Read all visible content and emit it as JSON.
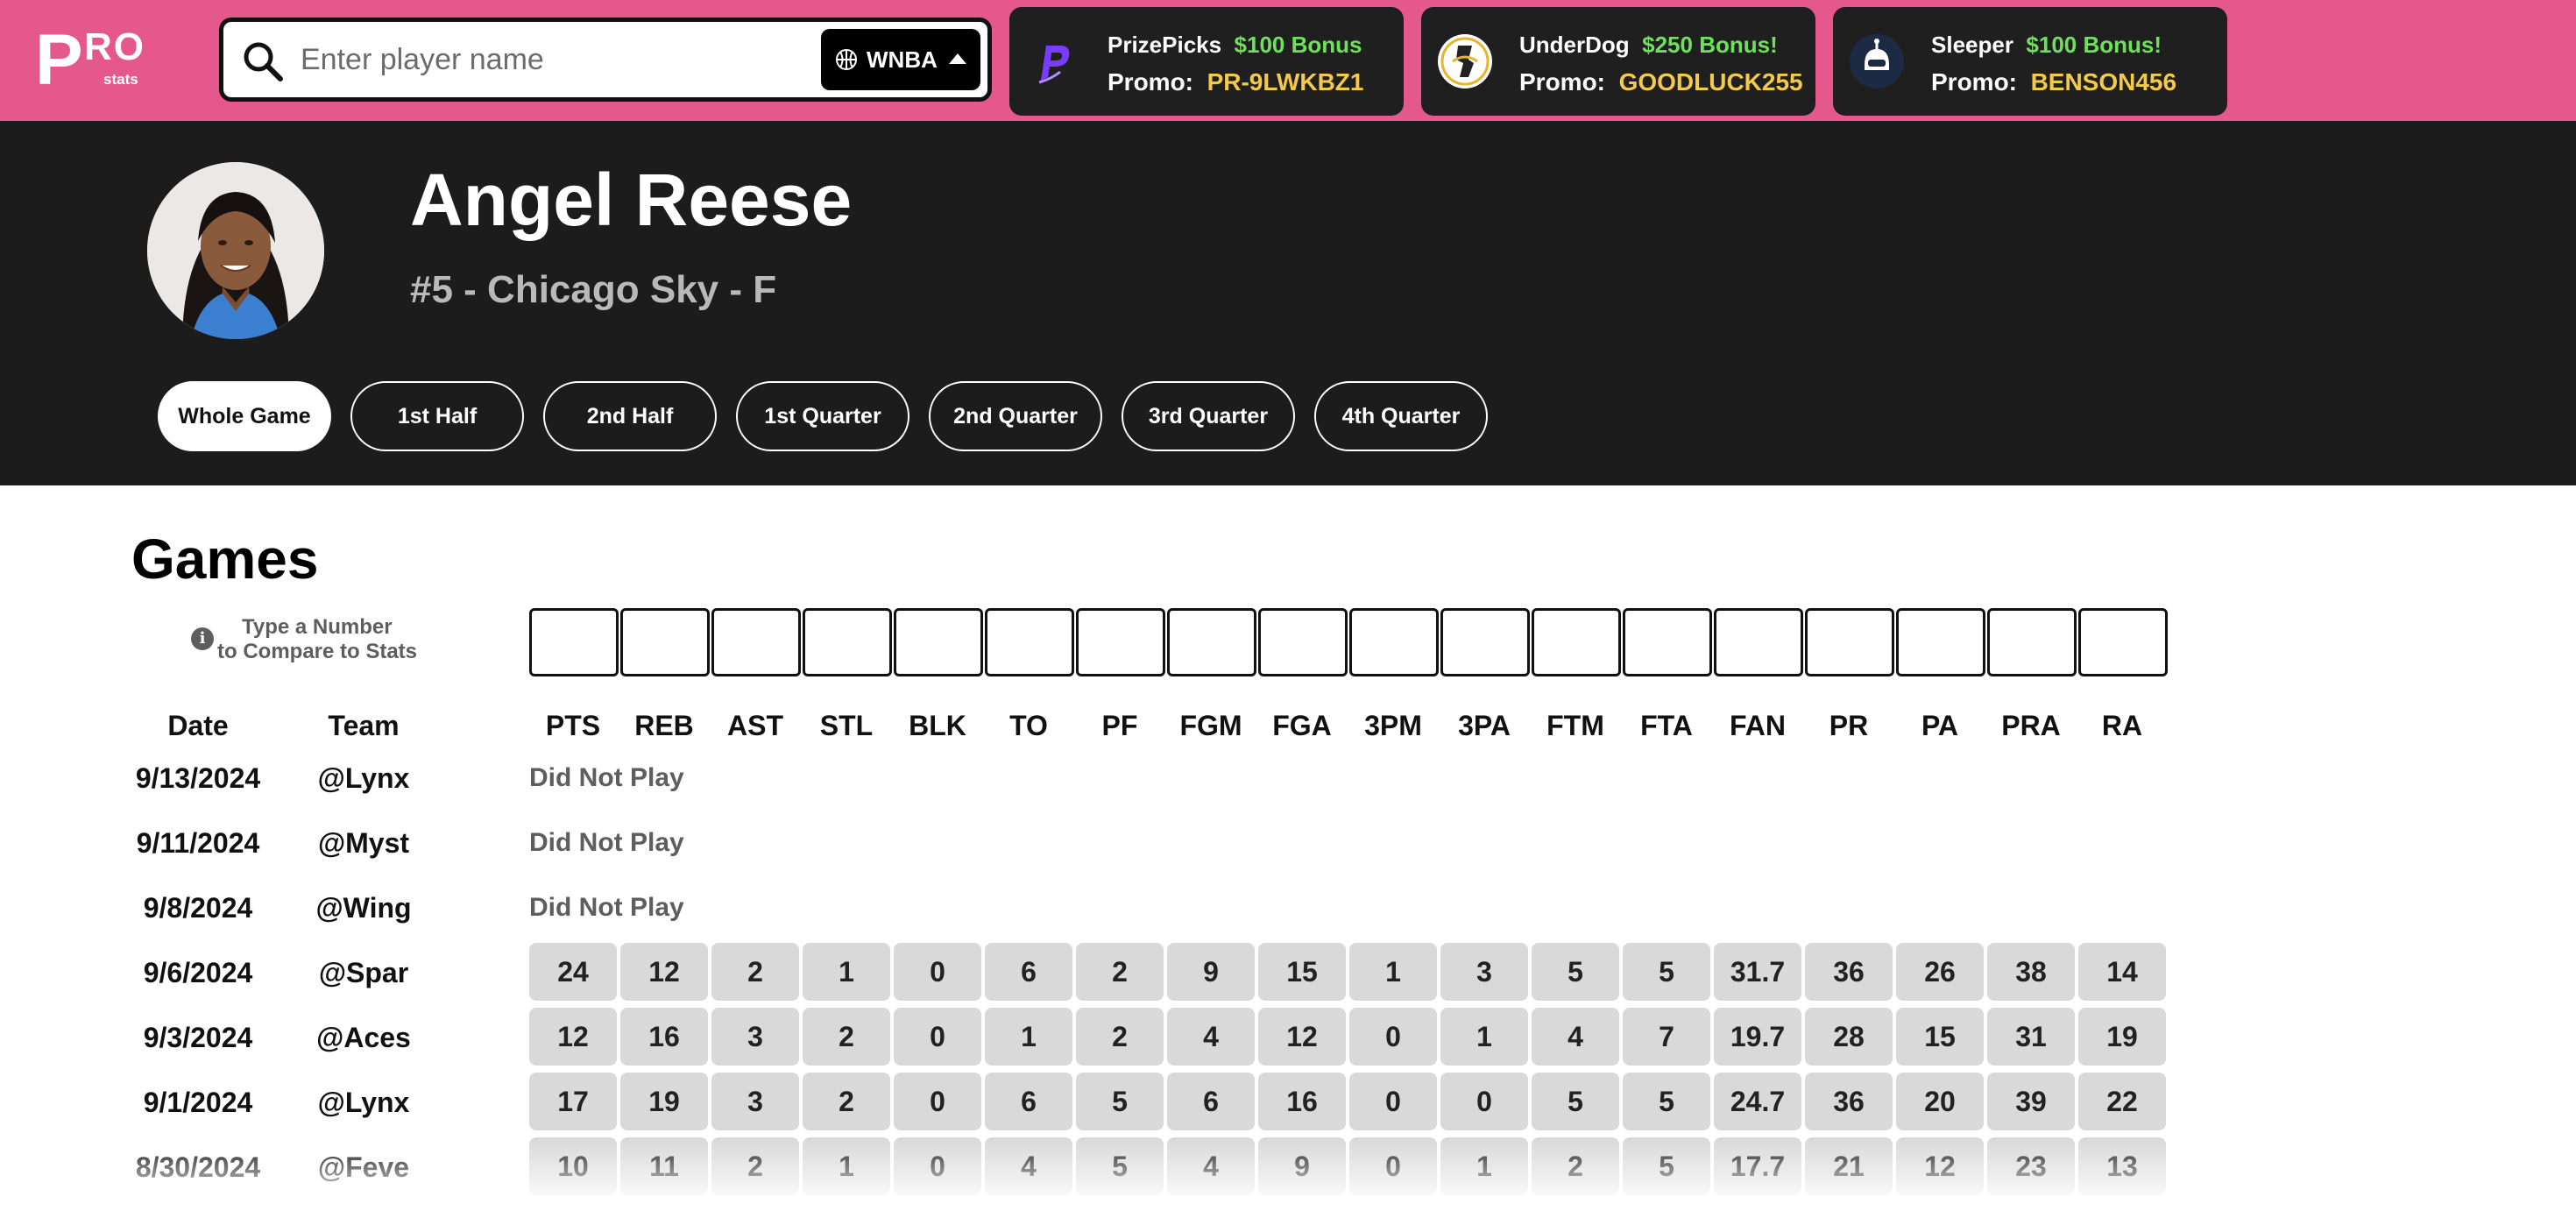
{
  "brand": {
    "logo_p": "P",
    "logo_ro": "RO",
    "logo_stats": "stats"
  },
  "search": {
    "placeholder": "Enter player name",
    "value": ""
  },
  "league": {
    "selected": "WNBA"
  },
  "promos": [
    {
      "brand": "PrizePicks",
      "bonus": "$100 Bonus",
      "promo_label": "Promo:",
      "code": "PR-9LWKBZ1",
      "icon": "prizepicks-logo"
    },
    {
      "brand": "UnderDog",
      "bonus": "$250 Bonus!",
      "promo_label": "Promo:",
      "code": "GOODLUCK255",
      "icon": "underdog-logo"
    },
    {
      "brand": "Sleeper",
      "bonus": "$100 Bonus!",
      "promo_label": "Promo:",
      "code": "BENSON456",
      "icon": "sleeper-logo"
    }
  ],
  "player": {
    "name": "Angel Reese",
    "subtitle": "#5 - Chicago Sky - F"
  },
  "period_tabs": [
    "Whole Game",
    "1st Half",
    "2nd Half",
    "1st Quarter",
    "2nd Quarter",
    "3rd Quarter",
    "4th Quarter"
  ],
  "active_period": "Whole Game",
  "games": {
    "title": "Games",
    "hint_line1": "Type a Number",
    "hint_line2": "to Compare to Stats",
    "date_header": "Date",
    "team_header": "Team",
    "stat_headers": [
      "PTS",
      "REB",
      "AST",
      "STL",
      "BLK",
      "TO",
      "PF",
      "FGM",
      "FGA",
      "3PM",
      "3PA",
      "FTM",
      "FTA",
      "FAN",
      "PR",
      "PA",
      "PRA",
      "RA"
    ],
    "rows": [
      {
        "date": "9/13/2024",
        "team": "@Lynx",
        "status": "Did Not Play",
        "stats": []
      },
      {
        "date": "9/11/2024",
        "team": "@Myst",
        "status": "Did Not Play",
        "stats": []
      },
      {
        "date": "9/8/2024",
        "team": "@Wing",
        "status": "Did Not Play",
        "stats": []
      },
      {
        "date": "9/6/2024",
        "team": "@Spar",
        "status": "",
        "stats": [
          "24",
          "12",
          "2",
          "1",
          "0",
          "6",
          "2",
          "9",
          "15",
          "1",
          "3",
          "5",
          "5",
          "31.7",
          "36",
          "26",
          "38",
          "14"
        ]
      },
      {
        "date": "9/3/2024",
        "team": "@Aces",
        "status": "",
        "stats": [
          "12",
          "16",
          "3",
          "2",
          "0",
          "1",
          "2",
          "4",
          "12",
          "0",
          "1",
          "4",
          "7",
          "19.7",
          "28",
          "15",
          "31",
          "19"
        ]
      },
      {
        "date": "9/1/2024",
        "team": "@Lynx",
        "status": "",
        "stats": [
          "17",
          "19",
          "3",
          "2",
          "0",
          "6",
          "5",
          "6",
          "16",
          "0",
          "0",
          "5",
          "5",
          "24.7",
          "36",
          "20",
          "39",
          "22"
        ]
      },
      {
        "date": "8/30/2024",
        "team": "@Feve",
        "status": "",
        "stats": [
          "10",
          "11",
          "2",
          "1",
          "0",
          "4",
          "5",
          "4",
          "9",
          "0",
          "1",
          "2",
          "5",
          "17.7",
          "21",
          "12",
          "23",
          "13"
        ]
      }
    ]
  }
}
